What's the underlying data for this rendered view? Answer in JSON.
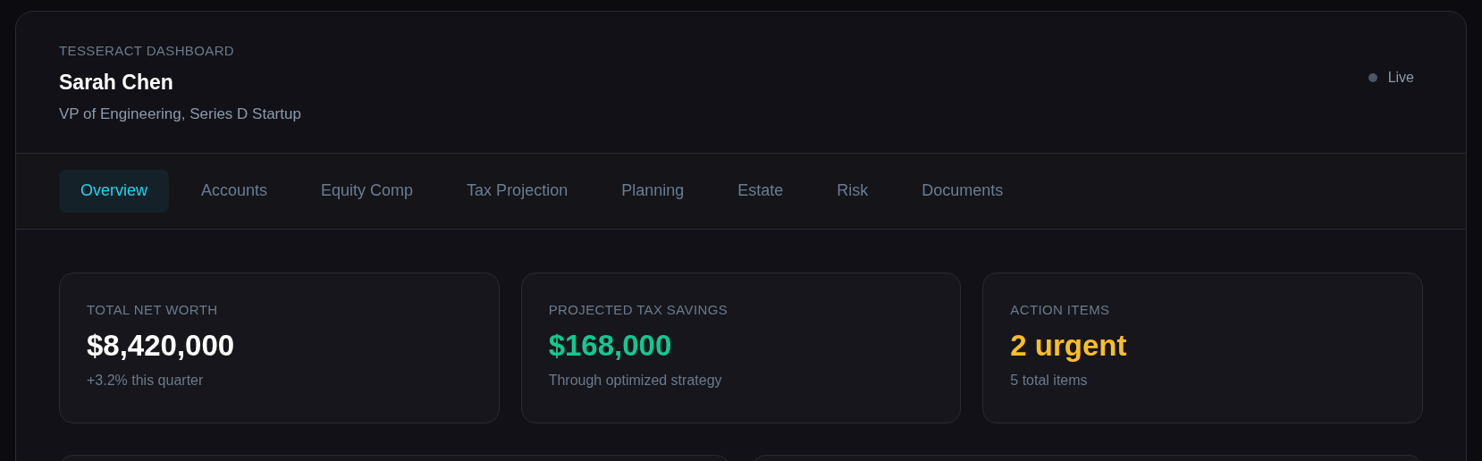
{
  "header": {
    "eyebrow": "TESSERACT DASHBOARD",
    "name": "Sarah Chen",
    "subtitle": "VP of Engineering, Series D Startup",
    "status": {
      "label": "Live",
      "active": false
    }
  },
  "tabs": [
    {
      "label": "Overview",
      "selected": true
    },
    {
      "label": "Accounts",
      "selected": false
    },
    {
      "label": "Equity Comp",
      "selected": false
    },
    {
      "label": "Tax Projection",
      "selected": false
    },
    {
      "label": "Planning",
      "selected": false
    },
    {
      "label": "Estate",
      "selected": false
    },
    {
      "label": "Risk",
      "selected": false
    },
    {
      "label": "Documents",
      "selected": false
    }
  ],
  "stats": [
    {
      "kind": "neutral",
      "label": "TOTAL NET WORTH",
      "value": "$8,420,000",
      "note": "+3.2% this quarter"
    },
    {
      "kind": "positive",
      "label": "PROJECTED TAX SAVINGS",
      "value": "$168,000",
      "note": "Through optimized strategy"
    },
    {
      "kind": "warning",
      "label": "ACTION ITEMS",
      "value": "2 urgent",
      "note": "5 total items"
    }
  ]
}
